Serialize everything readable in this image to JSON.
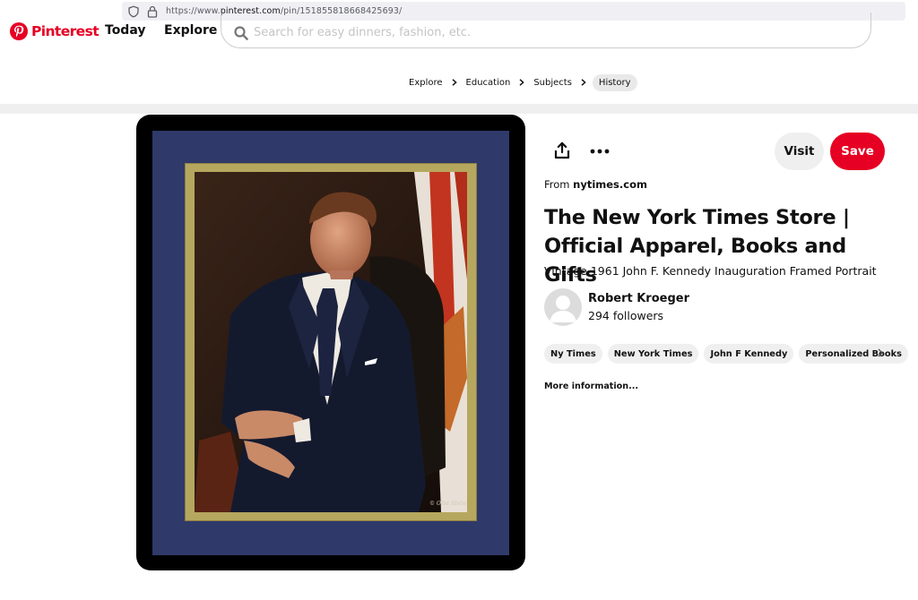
{
  "browser": {
    "url_prefix": "https://www.",
    "url_host": "pinterest.com",
    "url_path": "/pin/151855818668425693/"
  },
  "header": {
    "logo_text": "Pinterest",
    "nav": {
      "today": "Today",
      "explore": "Explore"
    },
    "search_placeholder": "Search for easy dinners, fashion, etc."
  },
  "breadcrumb": {
    "items": [
      "Explore",
      "Education",
      "Subjects",
      "History"
    ],
    "active_index": 3
  },
  "pin": {
    "image_icon": "portrait-photo",
    "from_prefix": "From ",
    "source_domain": "nytimes.com",
    "title": "The New York Times Store | Official Apparel, Books and Gifts",
    "description": "Vintage 1961 John F. Kennedy Inauguration Framed Portrait",
    "actions": {
      "visit": "Visit",
      "save": "Save"
    },
    "creator": {
      "name": "Robert Kroeger",
      "followers": "294 followers"
    },
    "tags": [
      "Ny Times",
      "New York Times",
      "John F Kennedy",
      "Personalized Books"
    ],
    "more_info": "More information..."
  },
  "colors": {
    "brand_red": "#e60023",
    "frame_black": "#000000",
    "mat_navy": "#2f3a6a",
    "gold_trim": "#b6a75f",
    "chip_gray": "#efefef"
  }
}
